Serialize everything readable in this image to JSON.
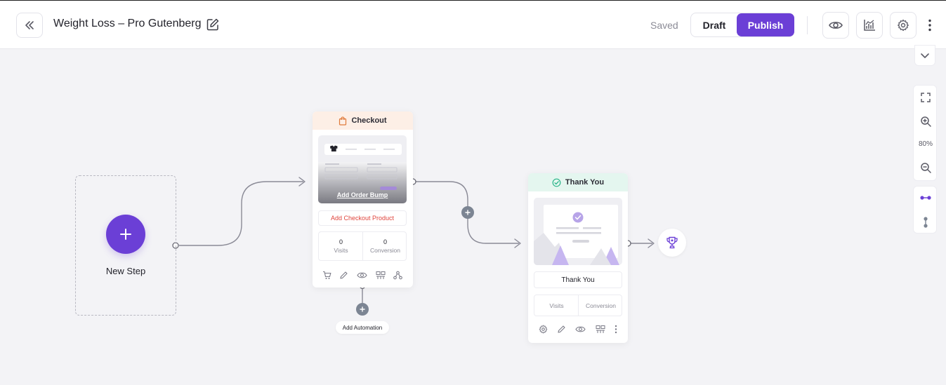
{
  "header": {
    "title": "Weight Loss – Pro Gutenberg",
    "saved_text": "Saved",
    "draft_label": "Draft",
    "publish_label": "Publish"
  },
  "canvas": {
    "zoom_level": "80%",
    "new_step_label": "New Step",
    "add_automation_label": "Add Automation"
  },
  "checkout_step": {
    "title": "Checkout",
    "order_bump_label": "Add Order Bump",
    "add_product_label": "Add Checkout Product",
    "visits_value": "0",
    "visits_label": "Visits",
    "conversion_value": "0",
    "conversion_label": "Conversion"
  },
  "thankyou_step": {
    "title": "Thank You",
    "name_label": "Thank You",
    "visits_label": "Visits",
    "conversion_label": "Conversion"
  },
  "colors": {
    "brand": "#6b3fd6",
    "checkout_header": "#fdefe6",
    "thankyou_header": "#e4f6ef",
    "danger": "#e0453d"
  }
}
